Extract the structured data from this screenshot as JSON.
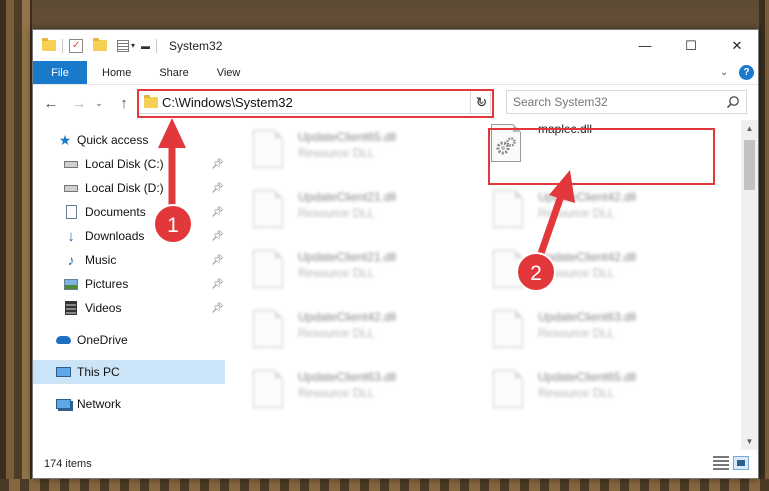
{
  "window": {
    "title": "System32",
    "controls": {
      "minimize": "—",
      "maximize": "☐",
      "close": "✕"
    }
  },
  "ribbon": {
    "tabs": [
      "File",
      "Home",
      "Share",
      "View"
    ],
    "help_icon": "?"
  },
  "navbar": {
    "address": "C:\\Windows\\System32",
    "search_placeholder": "Search System32"
  },
  "sidebar": {
    "items": [
      {
        "label": "Quick access",
        "icon": "star-icon"
      },
      {
        "label": "Local Disk (C:)",
        "icon": "drive-icon",
        "pinned": true
      },
      {
        "label": "Local Disk (D:)",
        "icon": "drive-icon",
        "pinned": true
      },
      {
        "label": "Documents",
        "icon": "document-icon",
        "pinned": true
      },
      {
        "label": "Downloads",
        "icon": "download-icon",
        "pinned": true
      },
      {
        "label": "Music",
        "icon": "music-icon",
        "pinned": true
      },
      {
        "label": "Pictures",
        "icon": "picture-icon",
        "pinned": true
      },
      {
        "label": "Videos",
        "icon": "video-icon",
        "pinned": true
      },
      {
        "label": "OneDrive",
        "icon": "cloud-icon"
      },
      {
        "label": "This PC",
        "icon": "computer-icon",
        "selected": true
      },
      {
        "label": "Network",
        "icon": "network-icon"
      }
    ]
  },
  "files": {
    "col1": [
      {
        "name": "UpdateClient65.dll",
        "type": "Resource DLL"
      },
      {
        "name": "UpdateClient21.dll",
        "type": "Resource DLL"
      },
      {
        "name": "UpdateClient21.dll",
        "type": "Resource DLL"
      },
      {
        "name": "UpdateClient42.dll",
        "type": "Resource DLL"
      },
      {
        "name": "UpdateClient63.dll",
        "type": "Resource DLL"
      }
    ],
    "col2": [
      {
        "name": "maplec.dll",
        "type": ""
      },
      {
        "name": "UpdateClient42.dll",
        "type": "Resource DLL"
      },
      {
        "name": "UpdateClient42.dll",
        "type": "Resource DLL"
      },
      {
        "name": "UpdateClient63.dll",
        "type": "Resource DLL"
      },
      {
        "name": "UpdateClient65.dll",
        "type": "Resource DLL"
      }
    ]
  },
  "statusbar": {
    "count": "174 items"
  },
  "annotations": {
    "badge1": "1",
    "badge2": "2",
    "color": "#e2383b"
  }
}
